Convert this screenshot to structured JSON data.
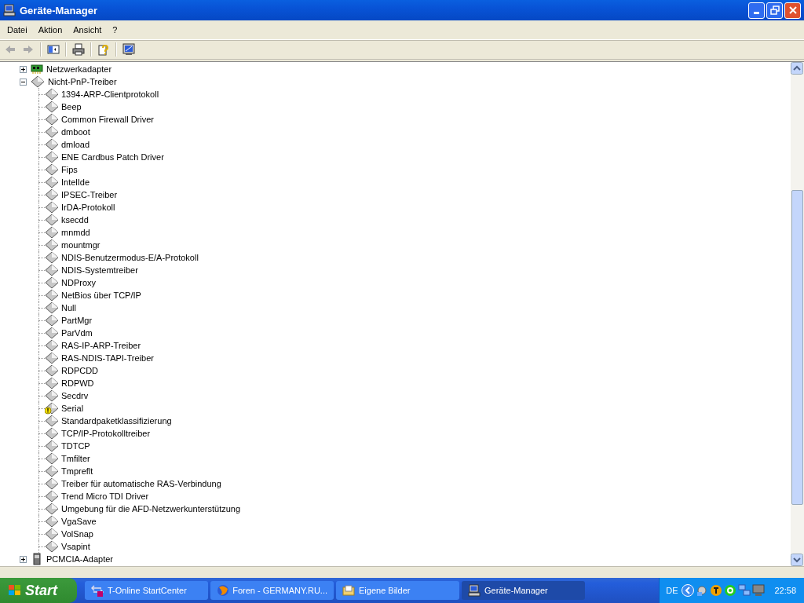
{
  "window": {
    "title": "Geräte-Manager"
  },
  "menu": [
    {
      "label": "Datei"
    },
    {
      "label": "Aktion"
    },
    {
      "label": "Ansicht"
    },
    {
      "label": "?"
    }
  ],
  "tree": [
    {
      "label": "Netzwerkadapter",
      "kind": "network",
      "expanded": false
    },
    {
      "label": "Nicht-PnP-Treiber",
      "kind": "driver",
      "expanded": true,
      "children": [
        {
          "label": "1394-ARP-Clientprotokoll",
          "warning": false
        },
        {
          "label": "Beep",
          "warning": false
        },
        {
          "label": "Common Firewall Driver",
          "warning": false
        },
        {
          "label": "dmboot",
          "warning": false
        },
        {
          "label": "dmload",
          "warning": false
        },
        {
          "label": "ENE Cardbus Patch Driver",
          "warning": false
        },
        {
          "label": "Fips",
          "warning": false
        },
        {
          "label": "IntelIde",
          "warning": false
        },
        {
          "label": "IPSEC-Treiber",
          "warning": false
        },
        {
          "label": "IrDA-Protokoll",
          "warning": false
        },
        {
          "label": "ksecdd",
          "warning": false
        },
        {
          "label": "mnmdd",
          "warning": false
        },
        {
          "label": "mountmgr",
          "warning": false
        },
        {
          "label": "NDIS-Benutzermodus-E/A-Protokoll",
          "warning": false
        },
        {
          "label": "NDIS-Systemtreiber",
          "warning": false
        },
        {
          "label": "NDProxy",
          "warning": false
        },
        {
          "label": "NetBios über TCP/IP",
          "warning": false
        },
        {
          "label": "Null",
          "warning": false
        },
        {
          "label": "PartMgr",
          "warning": false
        },
        {
          "label": "ParVdm",
          "warning": false
        },
        {
          "label": "RAS-IP-ARP-Treiber",
          "warning": false
        },
        {
          "label": "RAS-NDIS-TAPI-Treiber",
          "warning": false
        },
        {
          "label": "RDPCDD",
          "warning": false
        },
        {
          "label": "RDPWD",
          "warning": false
        },
        {
          "label": "Secdrv",
          "warning": false
        },
        {
          "label": "Serial",
          "warning": true
        },
        {
          "label": "Standardpaketklassifizierung",
          "warning": false
        },
        {
          "label": "TCP/IP-Protokolltreiber",
          "warning": false
        },
        {
          "label": "TDTCP",
          "warning": false
        },
        {
          "label": "Tmfilter",
          "warning": false
        },
        {
          "label": "Tmpreflt",
          "warning": false
        },
        {
          "label": "Treiber für automatische RAS-Verbindung",
          "warning": false
        },
        {
          "label": "Trend Micro TDI Driver",
          "warning": false
        },
        {
          "label": "Umgebung für die AFD-Netzwerkunterstützung",
          "warning": false
        },
        {
          "label": "VgaSave",
          "warning": false
        },
        {
          "label": "VolSnap",
          "warning": false
        },
        {
          "label": "Vsapint",
          "warning": false
        }
      ]
    },
    {
      "label": "PCMCIA-Adapter",
      "kind": "card",
      "expanded": false
    }
  ],
  "taskbar": {
    "start": "Start",
    "tasks": [
      {
        "label": "T-Online StartCenter",
        "selected": false
      },
      {
        "label": "Foren - GERMANY.RU...",
        "selected": false
      },
      {
        "label": "Eigene Bilder",
        "selected": false
      },
      {
        "label": "Geräte-Manager",
        "selected": true
      }
    ],
    "language": "DE",
    "clock": "22:58"
  }
}
